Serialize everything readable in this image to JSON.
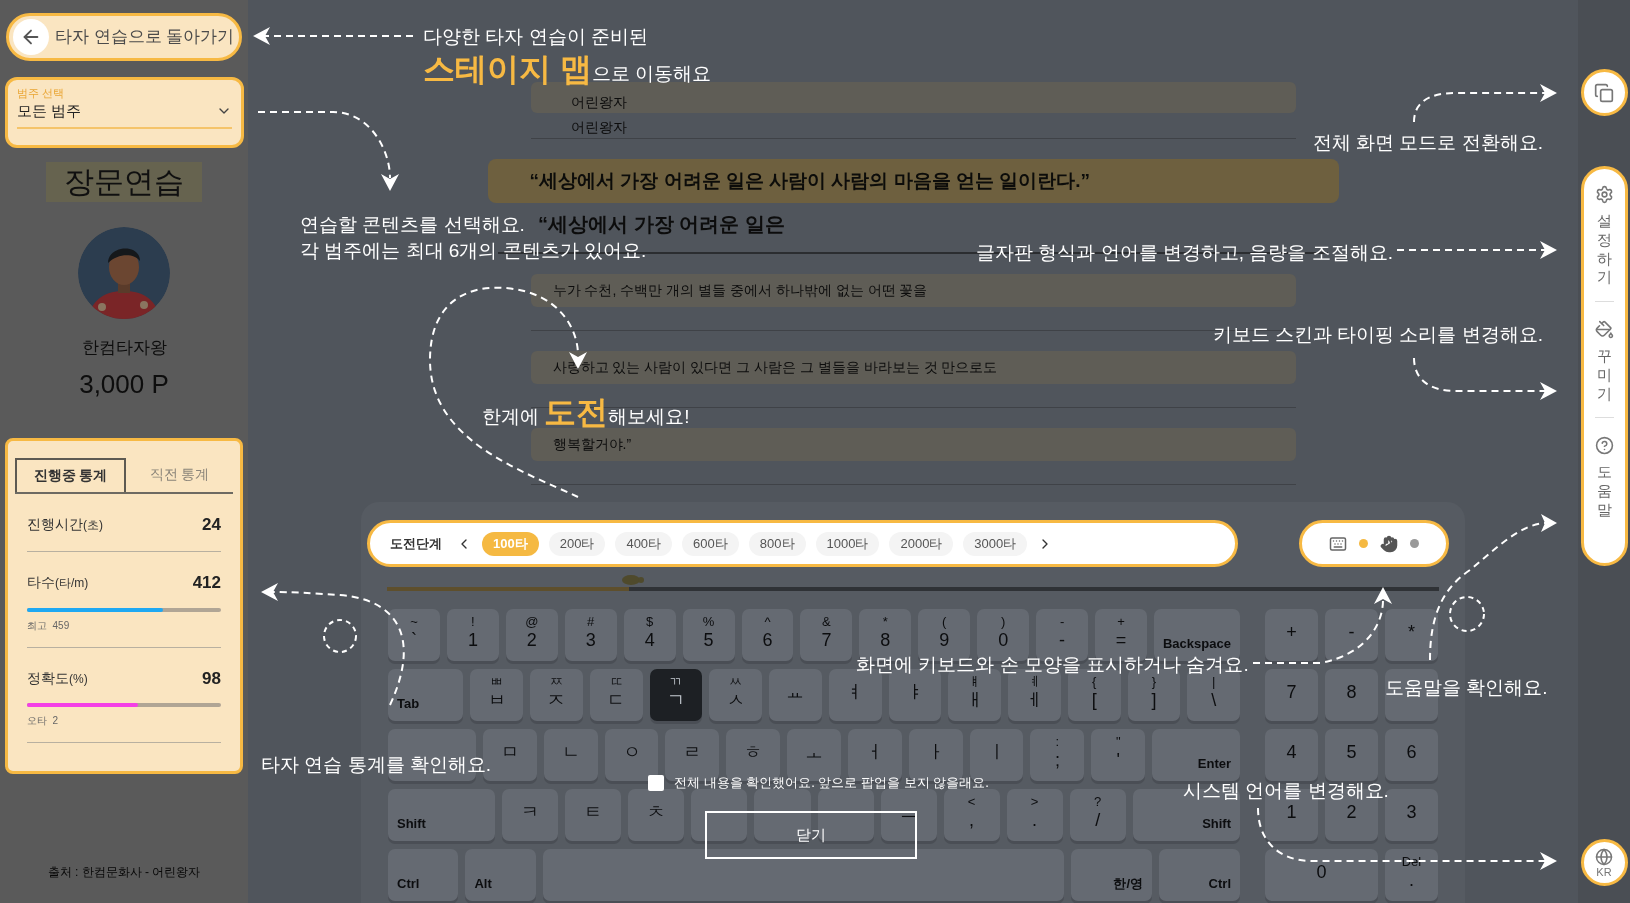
{
  "back_button": {
    "label": "타자 연습으로 돌아가기"
  },
  "category_select": {
    "label": "범주 선택",
    "value": "모든 범주"
  },
  "mode_title": "장문연습",
  "profile": {
    "name": "한컴타자왕",
    "points": "3,000 P"
  },
  "stats": {
    "tabs": [
      {
        "label": "진행중 통계",
        "selected": true
      },
      {
        "label": "직전 통계",
        "selected": false
      }
    ],
    "rows": [
      {
        "label": "진행시간",
        "unit": "(초)",
        "value": "24"
      },
      {
        "label": "타수",
        "unit": "(타/m)",
        "value": "412",
        "level": 0.7,
        "color": "#1ea8f2",
        "sub": "최고  459"
      },
      {
        "label": "정확도",
        "unit": "(%)",
        "value": "98",
        "level": 0.57,
        "color": "#f43ee6",
        "sub": "오타  2"
      }
    ]
  },
  "source_credit": "출처 : 한컴문화사 - 어린왕자",
  "text_lines": [
    {
      "kind": "title",
      "source": "어린왕자",
      "typed": "어린왕자"
    },
    {
      "kind": "current",
      "source": "“세상에서 가장 어려운 일은 사람이 사람의 마음을 얻는 일이란다.”",
      "typed": "“세상에서 가장 어려운 일은"
    },
    {
      "kind": "plain",
      "source": "누가 수천, 수백만 개의 별들 중에서 하나밖에 없는 어떤 꽃을"
    },
    {
      "kind": "plain",
      "source": "사랑하고 있는 사람이 있다면 그 사람은 그 별들을 바라보는 것 만으로도"
    },
    {
      "kind": "plain",
      "source": "행복할거야.”"
    }
  ],
  "challenge": {
    "label": "도전단계",
    "level": 0.23,
    "steps": [
      {
        "label": "100타",
        "selected": true
      },
      {
        "label": "200타",
        "selected": false
      },
      {
        "label": "400타",
        "selected": false
      },
      {
        "label": "600타",
        "selected": false
      },
      {
        "label": "800타",
        "selected": false
      },
      {
        "label": "1000타",
        "selected": false
      },
      {
        "label": "2000타",
        "selected": false
      },
      {
        "label": "3000타",
        "selected": false
      }
    ]
  },
  "display_toggles": [
    {
      "kind": "keyboard",
      "on": true
    },
    {
      "kind": "hand",
      "on": false
    }
  ],
  "keyboard": {
    "main_rows": [
      [
        {
          "kind": "char",
          "top": "~",
          "main": "`",
          "next": false
        },
        {
          "kind": "char",
          "top": "!",
          "main": "1",
          "next": false
        },
        {
          "kind": "char",
          "top": "@",
          "main": "2",
          "next": false
        },
        {
          "kind": "char",
          "top": "#",
          "main": "3",
          "next": false
        },
        {
          "kind": "char",
          "top": "$",
          "main": "4",
          "next": false
        },
        {
          "kind": "char",
          "top": "%",
          "main": "5",
          "next": false
        },
        {
          "kind": "char",
          "top": "^",
          "main": "6",
          "next": false
        },
        {
          "kind": "char",
          "top": "&",
          "main": "7",
          "next": false
        },
        {
          "kind": "char",
          "top": "*",
          "main": "8",
          "next": false
        },
        {
          "kind": "char",
          "top": "(",
          "main": "9",
          "next": false
        },
        {
          "kind": "char",
          "top": ")",
          "main": "0",
          "next": false
        },
        {
          "kind": "char",
          "top": "-",
          "main": "-",
          "next": false
        },
        {
          "kind": "char",
          "top": "+",
          "main": "=",
          "next": false
        },
        {
          "kind": "backspace",
          "main": "Backspace",
          "next": false
        }
      ],
      [
        {
          "kind": "tab",
          "main": "Tab",
          "next": false
        },
        {
          "kind": "char",
          "top": "ㅃ",
          "main": "ㅂ",
          "next": false
        },
        {
          "kind": "char",
          "top": "ㅉ",
          "main": "ㅈ",
          "next": false
        },
        {
          "kind": "char",
          "top": "ㄸ",
          "main": "ㄷ",
          "next": false
        },
        {
          "kind": "char",
          "top": "ㄲ",
          "main": "ㄱ",
          "next": true
        },
        {
          "kind": "char",
          "top": "ㅆ",
          "main": "ㅅ",
          "next": false
        },
        {
          "kind": "char",
          "main": "ㅛ",
          "next": false
        },
        {
          "kind": "char",
          "main": "ㅕ",
          "next": false
        },
        {
          "kind": "char",
          "main": "ㅑ",
          "next": false
        },
        {
          "kind": "char",
          "top": "ㅒ",
          "main": "ㅐ",
          "next": false
        },
        {
          "kind": "char",
          "top": "ㅖ",
          "main": "ㅔ",
          "next": false
        },
        {
          "kind": "char",
          "top": "{",
          "main": "[",
          "next": false
        },
        {
          "kind": "char",
          "top": "}",
          "main": "]",
          "next": false
        },
        {
          "kind": "char",
          "top": "|",
          "main": "\\",
          "next": false
        }
      ],
      [
        {
          "kind": "caps",
          "next": false
        },
        {
          "kind": "char",
          "main": "ㅁ",
          "next": false
        },
        {
          "kind": "char",
          "main": "ㄴ",
          "next": false
        },
        {
          "kind": "char",
          "main": "ㅇ",
          "next": false
        },
        {
          "kind": "char",
          "main": "ㄹ",
          "next": false
        },
        {
          "kind": "char",
          "main": "ㅎ",
          "next": false
        },
        {
          "kind": "char",
          "main": "ㅗ",
          "next": false
        },
        {
          "kind": "char",
          "main": "ㅓ",
          "next": false
        },
        {
          "kind": "char",
          "main": "ㅏ",
          "next": false
        },
        {
          "kind": "char",
          "main": "ㅣ",
          "next": false
        },
        {
          "kind": "char",
          "top": ":",
          "main": ";",
          "next": false
        },
        {
          "kind": "char",
          "top": "\"",
          "main": "'",
          "next": false
        },
        {
          "kind": "enter",
          "main": "Enter",
          "next": false
        }
      ],
      [
        {
          "kind": "shift",
          "main": "Shift",
          "next": false
        },
        {
          "kind": "char",
          "main": "ㅋ",
          "next": false
        },
        {
          "kind": "char",
          "main": "ㅌ",
          "next": false
        },
        {
          "kind": "char",
          "main": "ㅊ",
          "next": false
        },
        {
          "kind": "char",
          "next": false
        },
        {
          "kind": "char",
          "next": false
        },
        {
          "kind": "char",
          "next": false
        },
        {
          "kind": "char",
          "main": "ㅡ",
          "next": false
        },
        {
          "kind": "char",
          "top": "<",
          "main": ",",
          "next": false
        },
        {
          "kind": "char",
          "top": ">",
          "main": ".",
          "next": false
        },
        {
          "kind": "char",
          "top": "?",
          "main": "/",
          "next": false
        },
        {
          "kind": "rshift",
          "main": "Shift",
          "next": false
        }
      ],
      [
        {
          "kind": "ctrl",
          "main": "Ctrl",
          "next": false
        },
        {
          "kind": "ctrl",
          "main": "Alt",
          "next": false
        },
        {
          "kind": "space",
          "next": false
        },
        {
          "kind": "lang",
          "main": "한/영",
          "next": false
        },
        {
          "kind": "rctrl",
          "main": "Ctrl",
          "next": false
        }
      ]
    ],
    "numpad": [
      {
        "kind": "char",
        "main": "+",
        "next": false
      },
      {
        "kind": "char",
        "main": "-",
        "next": false
      },
      {
        "kind": "char",
        "main": "*",
        "next": false
      },
      {
        "kind": "char",
        "main": "7",
        "next": false
      },
      {
        "kind": "char",
        "main": "8",
        "next": false
      },
      {
        "kind": "char",
        "next": false
      },
      {
        "kind": "char",
        "main": "4",
        "next": false
      },
      {
        "kind": "char",
        "main": "5",
        "next": false
      },
      {
        "kind": "char",
        "main": "6",
        "next": false
      },
      {
        "kind": "char",
        "main": "1",
        "next": false
      },
      {
        "kind": "char",
        "main": "2",
        "next": false
      },
      {
        "kind": "char",
        "main": "3",
        "next": false
      },
      {
        "kind": "zero",
        "main": "0",
        "next": false
      },
      {
        "kind": "char",
        "top": "Del",
        "main": ".",
        "next": false
      }
    ]
  },
  "side_menu": [
    {
      "kind": "settings",
      "label": "설정하기"
    },
    {
      "kind": "decorate",
      "label": "꾸미기"
    },
    {
      "kind": "help",
      "label": "도움말"
    }
  ],
  "language_button": {
    "label": "KR"
  },
  "guide": {
    "annotations": [
      {
        "lines": [
          "다양한 타자 연습이 준비된",
          "**스테이지 맵**으로 이동해요"
        ]
      },
      {
        "lines": [
          "연습할 콘텐츠를 선택해요.",
          "각 범주에는 최대 6개의 콘텐츠가 있어요."
        ]
      },
      {
        "lines": [
          "한계에 **도전**해보세요!"
        ]
      },
      {
        "lines": [
          "타자 연습 통계를 확인해요."
        ]
      },
      {
        "lines": [
          "전체 화면 모드로 전환해요."
        ]
      },
      {
        "lines": [
          "글자판 형식과 언어를 변경하고, 음량을 조절해요."
        ]
      },
      {
        "lines": [
          "키보드 스킨과 타이핑 소리를 변경해요."
        ]
      },
      {
        "lines": [
          "화면에 키보드와 손 모양을 표시하거나 숨겨요."
        ]
      },
      {
        "lines": [
          "도움말을 확인해요."
        ]
      },
      {
        "lines": [
          "시스템 언어를 변경해요."
        ]
      }
    ],
    "dont_show_again": {
      "label": "전체 내용을 확인했어요. 앞으로 팝업을 보지 않을래요.",
      "checked": false
    },
    "close_button": {
      "label": "닫기"
    }
  }
}
